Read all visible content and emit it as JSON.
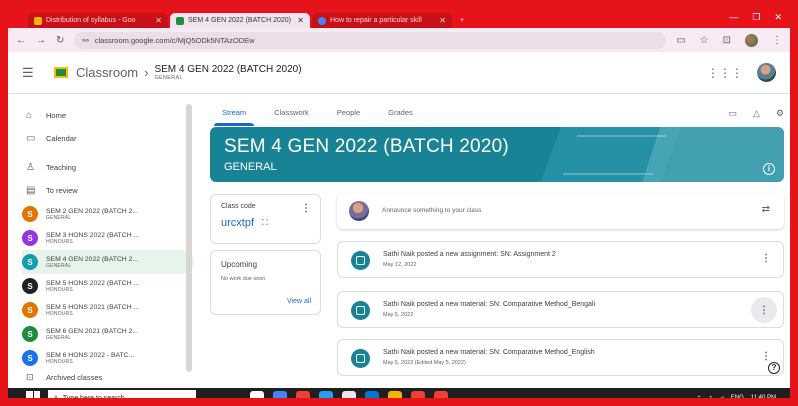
{
  "browser": {
    "tabs": [
      {
        "title": "Distribution of syllabus - Goo",
        "active": false
      },
      {
        "title": "SEM 4 GEN 2022 (BATCH 2020)",
        "active": true
      },
      {
        "title": "How to repair a particular skill",
        "active": false
      }
    ],
    "url": "classroom.google.com/c/MjQ5ODk5NTAzODEw"
  },
  "header": {
    "app_name": "Classroom",
    "class_title": "SEM 4 GEN 2022 (BATCH 2020)",
    "class_section": "GENERAL"
  },
  "sidebar": {
    "items": [
      {
        "label": "Home",
        "icon": "home-icon",
        "glyph": "⌂"
      },
      {
        "label": "Calendar",
        "icon": "calendar-icon",
        "glyph": "▭"
      }
    ],
    "teaching": [
      {
        "label": "Teaching",
        "icon": "teaching-icon",
        "glyph": "♙"
      },
      {
        "label": "To review",
        "icon": "review-icon",
        "glyph": "▤"
      }
    ],
    "classes": [
      {
        "letter": "S",
        "name": "SEM 2 GEN 2022 (BATCH 2...",
        "section": "GENERAL",
        "color": "#e37400"
      },
      {
        "letter": "S",
        "name": "SEM 3 HONS 2022 (BATCH ...",
        "section": "HONOURS",
        "color": "#9334e6"
      },
      {
        "letter": "S",
        "name": "SEM 4 GEN 2022 (BATCH 2...",
        "section": "GENERAL",
        "color": "#129eaf",
        "active": true
      },
      {
        "letter": "S",
        "name": "SEM 5 HONS 2022 (BATCH ...",
        "section": "HONOURS",
        "color": "#202124"
      },
      {
        "letter": "S",
        "name": "SEM 5 HONS 2021 (BATCH ...",
        "section": "HONOURS",
        "color": "#e37400"
      },
      {
        "letter": "S",
        "name": "SEM 6 GEN 2021 (BATCH 2...",
        "section": "GENERAL",
        "color": "#1e8e3e"
      },
      {
        "letter": "S",
        "name": "SEM 6 HONS 2022 - BATC...",
        "section": "HONOURS",
        "color": "#1a73e8"
      }
    ],
    "archived": "Archived classes"
  },
  "tabs": [
    "Stream",
    "Classwork",
    "People",
    "Grades"
  ],
  "banner": {
    "title": "SEM 4 GEN 2022 (BATCH 2020)",
    "subtitle": "GENERAL",
    "color": "#198396"
  },
  "class_code": {
    "label": "Class code",
    "value": "urcxtpf"
  },
  "upcoming": {
    "title": "Upcoming",
    "empty": "No work due soon",
    "view_all": "View all"
  },
  "stream": {
    "announce_placeholder": "Announce something to your class",
    "posts": [
      {
        "title": "Sathi Naik posted a new assignment: SN: Assignment 2",
        "date": "May 12, 2022",
        "type": "assignment"
      },
      {
        "title": "Sathi Naik posted a new material: SN: Comparative Method_Bengali",
        "date": "May 5, 2022",
        "type": "material"
      },
      {
        "title": "Sathi Naik posted a new material: SN: Comparative Method_English",
        "date": "May 5, 2022 (Edited May 5, 2022)",
        "type": "material"
      }
    ]
  },
  "taskbar": {
    "search_placeholder": "Type here to search",
    "time": "11:40 PM",
    "lang": "ENG",
    "app_colors": [
      "#ffffff",
      "#4285f4",
      "#ea4335",
      "#1da1f2",
      "#e8e8e8",
      "#0078d4",
      "#f4b400",
      "#ea4335",
      "#ea4335"
    ]
  }
}
